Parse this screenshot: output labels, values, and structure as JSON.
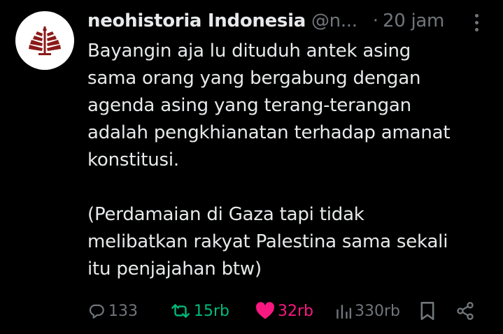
{
  "tweet": {
    "author_name": "neohistoria Indonesia",
    "author_handle": "@n...",
    "separator": "·",
    "timestamp": "20 jam",
    "text": "Bayangin aja lu dituduh antek asing\nsama orang yang bergabung dengan\nagenda asing yang terang-terangan\nadalah pengkhianatan terhadap amanat\nkonstitusi.\n\n(Perdamaian di Gaza tapi tidak\nmelibatkan rakyat Palestina sama sekali\nitu penjajahan btw)"
  },
  "actions": {
    "replies": "133",
    "reposts": "15rb",
    "likes": "32rb",
    "views": "330rb"
  },
  "colors": {
    "background": "#000000",
    "text": "#e7e9ea",
    "muted": "#71767b",
    "repost_active": "#00ba7c",
    "like_active": "#f91880",
    "avatar_logo": "#8b1a1a"
  },
  "icons": {
    "avatar": "neohistoria-logo",
    "more": "more-vertical-icon",
    "reply": "reply-icon",
    "repost": "repost-icon",
    "like": "heart-icon",
    "views": "views-icon",
    "bookmark": "bookmark-icon",
    "share": "share-icon"
  }
}
